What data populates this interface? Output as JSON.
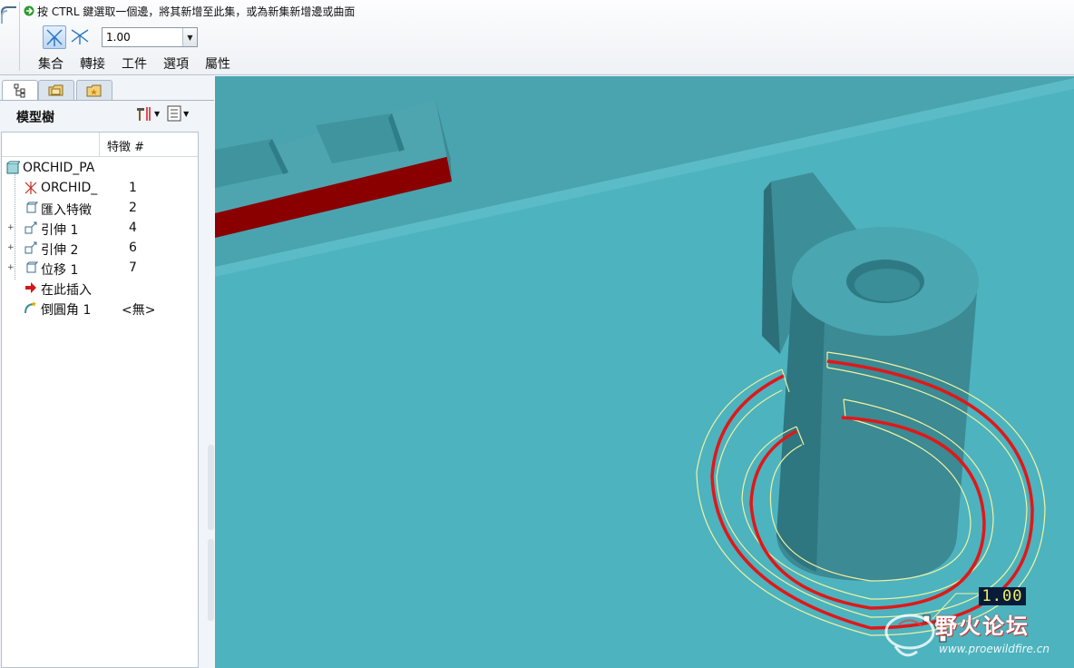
{
  "dashboard": {
    "prompt": "按 CTRL 鍵選取一個邊，將其新增至此集，或為新集新增邊或曲面",
    "radius_value": "1.00",
    "tabs": [
      "集合",
      "轉接",
      "工件",
      "選項",
      "屬性"
    ]
  },
  "navigator": {
    "title": "模型樹",
    "column_header": "特徵 #",
    "items": [
      {
        "label": "ORCHID_PA",
        "number": "",
        "icon": "part-icon",
        "expandable": false
      },
      {
        "label": "ORCHID_",
        "number": "1",
        "icon": "coordinate-system-icon",
        "expandable": false
      },
      {
        "label": "匯入特徵",
        "number": "2",
        "icon": "import-feature-icon",
        "expandable": false
      },
      {
        "label": "引伸 1",
        "number": "4",
        "icon": "extrude-icon",
        "expandable": true
      },
      {
        "label": "引伸 2",
        "number": "6",
        "icon": "extrude-icon",
        "expandable": true
      },
      {
        "label": "位移 1",
        "number": "7",
        "icon": "offset-icon",
        "expandable": true
      },
      {
        "label": "在此插入",
        "number": "",
        "icon": "insert-here-arrow-icon",
        "expandable": false
      },
      {
        "label": "倒圓角 1",
        "number": "<無>",
        "icon": "round-icon",
        "expandable": false
      }
    ]
  },
  "viewport": {
    "dimension_label": "1.00"
  },
  "watermark": {
    "title": "野火论坛",
    "url": "www.proewildfire.cn"
  },
  "colors": {
    "background": "#4fb0bb",
    "model": "#3c8e99",
    "highlight": "#e01818",
    "preview": "#f2f2a0",
    "rib": "#8a0000"
  }
}
